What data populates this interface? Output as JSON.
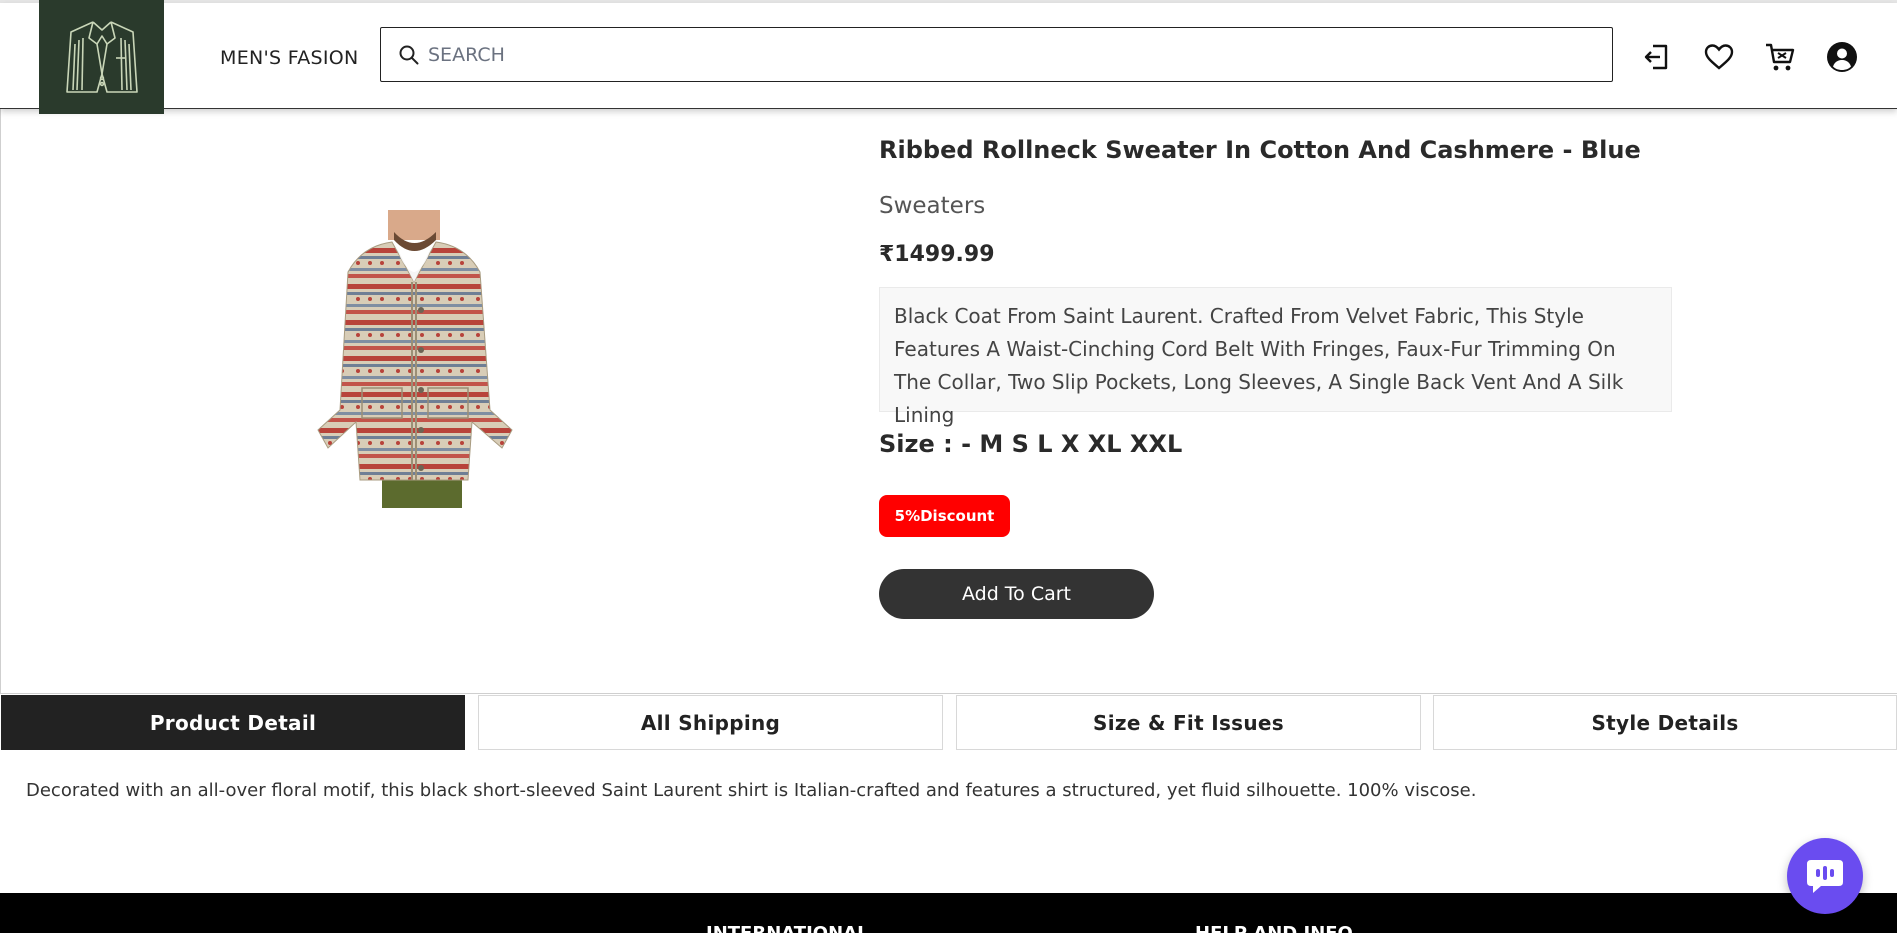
{
  "header": {
    "brand": "MEN'S FASION",
    "search": {
      "placeholder": "SEARCH",
      "value": ""
    },
    "icons": [
      "login-icon",
      "heart-icon",
      "cart-icon",
      "user-icon"
    ]
  },
  "product": {
    "title": "Ribbed Rollneck Sweater In Cotton And Cashmere - Blue",
    "category": "Sweaters",
    "price": "₹1499.99",
    "description": "Black Coat From Saint Laurent. Crafted From Velvet Fabric, This Style Features A Waist-Cinching Cord Belt With Fringes, Faux-Fur Trimming On The Collar, Two Slip Pockets, Long Sleeves, A Single Back Vent And A Silk Lining",
    "size_label": "Size : -",
    "sizes": "M S L X XL XXL",
    "discount": "5%Discount",
    "add_to_cart": "Add To Cart"
  },
  "tabs": [
    {
      "label": "Product Detail",
      "active": true
    },
    {
      "label": "All Shipping",
      "active": false
    },
    {
      "label": "Size & Fit Issues",
      "active": false
    },
    {
      "label": "Style Details",
      "active": false
    }
  ],
  "tab_content": "Decorated with an all-over floral motif, this black short-sleeved Saint Laurent shirt is Italian-crafted and features a structured, yet fluid silhouette. 100% viscose.",
  "footer": {
    "headings": [
      "INTERNATIONAL",
      "HELP AND INFO"
    ]
  },
  "colors": {
    "logo_bg": "#2a3a2c",
    "discount_bg": "#ff0000",
    "button_bg": "#333333",
    "active_tab_bg": "#222222",
    "chat_bg": "#6a4cf0",
    "footer_bg": "#000000"
  }
}
